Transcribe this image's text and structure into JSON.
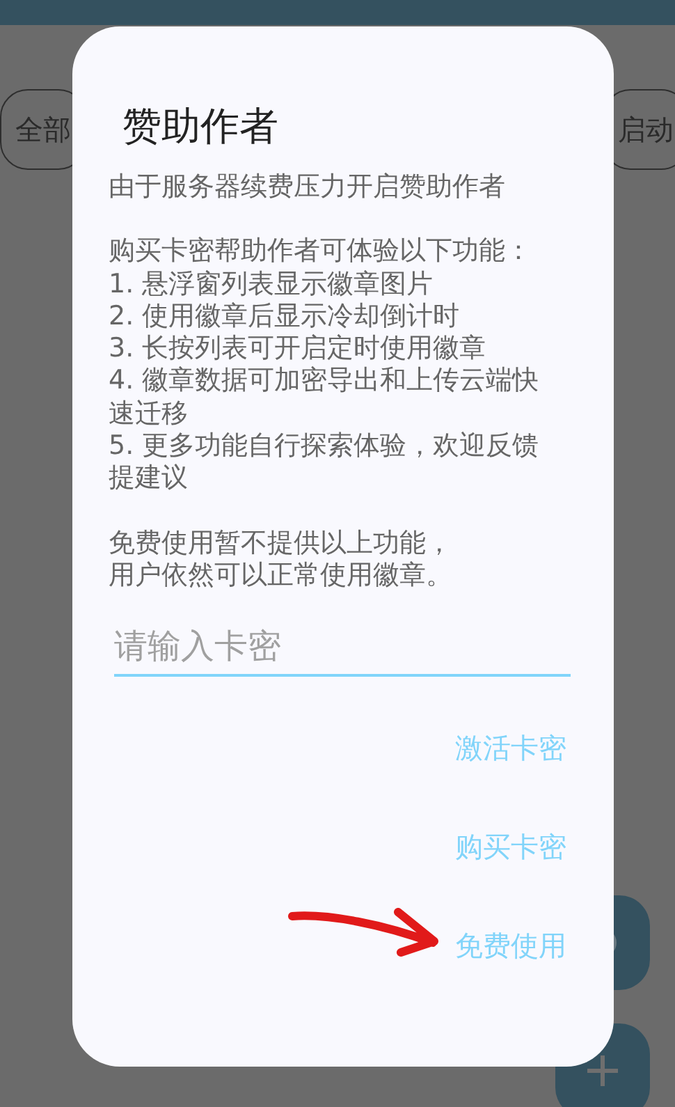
{
  "background": {
    "chips": [
      "全部",
      "启动"
    ]
  },
  "dialog": {
    "title": "赞助作者",
    "paragraphs": [
      [
        "由于服务器续费压力开启赞助作者"
      ],
      [
        "购买卡密帮助作者可体验以下功能：",
        "1. 悬浮窗列表显示徽章图片",
        "2. 使用徽章后显示冷却倒计时",
        "3. 长按列表可开启定时使用徽章",
        "4. 徽章数据可加密导出和上传云端快速迁移",
        "5. 更多功能自行探索体验，欢迎反馈提建议"
      ],
      [
        "免费使用暂不提供以上功能，",
        "用户依然可以正常使用徽章。"
      ]
    ],
    "input": {
      "placeholder": "请输入卡密"
    },
    "buttons": [
      "激活卡密",
      "购买卡密",
      "免费使用"
    ]
  }
}
